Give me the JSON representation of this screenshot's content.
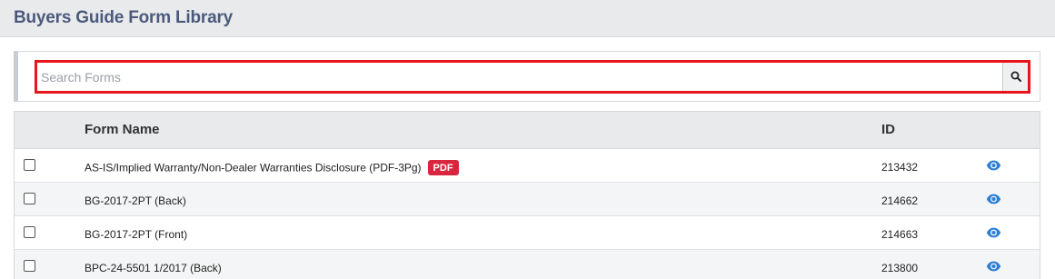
{
  "header": {
    "title": "Buyers Guide Form Library"
  },
  "search": {
    "placeholder": "Search Forms",
    "value": "",
    "icon": "search-icon"
  },
  "table": {
    "columns": {
      "name": "Form Name",
      "id": "ID"
    },
    "rows": [
      {
        "name": "AS-IS/Implied Warranty/Non-Dealer Warranties Disclosure (PDF-3Pg)",
        "badge": "PDF",
        "id": "213432",
        "checked": false,
        "icon": "eye-icon"
      },
      {
        "name": "BG-2017-2PT (Back)",
        "badge": "",
        "id": "214662",
        "checked": false,
        "icon": "eye-icon"
      },
      {
        "name": "BG-2017-2PT (Front)",
        "badge": "",
        "id": "214663",
        "checked": false,
        "icon": "eye-icon"
      },
      {
        "name": "BPC-24-5501 1/2017 (Back)",
        "badge": "",
        "id": "213800",
        "checked": false,
        "icon": "eye-icon"
      }
    ]
  },
  "colors": {
    "title": "#4b5a7c",
    "highlight_border": "#e8141c",
    "badge": "#d7263d",
    "eye": "#2b7fd6"
  }
}
